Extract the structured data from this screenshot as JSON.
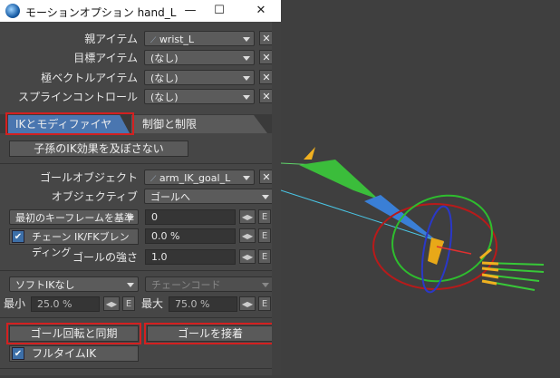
{
  "window": {
    "title": "モーションオプション hand_L",
    "minimize": "—",
    "maximize": "☐",
    "close": "✕"
  },
  "items": {
    "parent": {
      "label": "親アイテム",
      "value": "wrist_L"
    },
    "target": {
      "label": "目標アイテム",
      "value": "(なし)"
    },
    "pole": {
      "label": "極ベクトルアイテム",
      "value": "(なし)"
    },
    "spline": {
      "label": "スプラインコントロール",
      "value": "(なし)"
    }
  },
  "x_label": "✕",
  "tabs": [
    {
      "label": "IKとモディファイヤ",
      "active": true
    },
    {
      "label": "制御と制限",
      "active": false
    }
  ],
  "ik_modifiers": {
    "child_ik_button": "子孫のIK効果を及ぼさない",
    "goal_object": {
      "label": "ゴールオブジェクト",
      "value": "arm_IK_goal_L"
    },
    "objective": {
      "label": "オブジェクティブ",
      "value": "ゴールへ"
    },
    "first_key": {
      "label": "最初のキーフレームを基準",
      "value": "0"
    },
    "chain_blend": {
      "label": "チェーン IK/FKブレンディング",
      "value": "0.0 %",
      "checked": true
    },
    "goal_strength": {
      "label": "ゴールの強さ",
      "value": "1.0"
    },
    "soft_ik": {
      "label": "ソフトIKなし"
    },
    "chain_code": {
      "label": "チェーンコード"
    },
    "min": {
      "label": "最小",
      "value": "25.0 %"
    },
    "max": {
      "label": "最大",
      "value": "75.0 %"
    },
    "sync_goal_rotation": "ゴール回転と同期",
    "attach_goal": "ゴールを接着",
    "fulltime_ik": {
      "label": "フルタイムIK",
      "checked": true
    },
    "e_label": "E",
    "arrows_label": "◀▶"
  },
  "colors": {
    "highlight_red": "#d42020",
    "active_tab": "#4a76b0",
    "check_blue": "#3d6fa8"
  }
}
